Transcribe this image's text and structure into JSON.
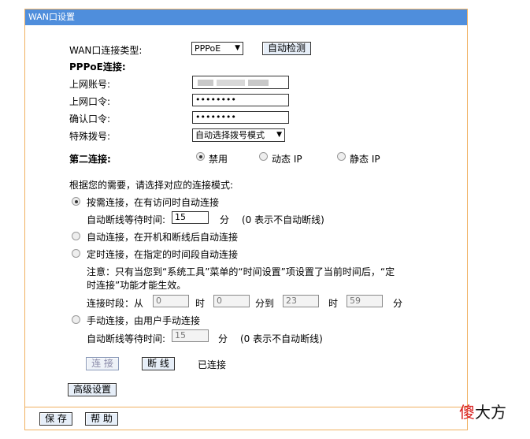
{
  "window_title": "WAN口设置",
  "conn_type": {
    "label": "WAN口连接类型:",
    "value": "PPPoE",
    "detect_button": "自动检测"
  },
  "pppoe": {
    "heading": "PPPoE连接:",
    "account_label": "上网账号:",
    "password_label": "上网口令:",
    "password_value": "••••••••",
    "confirm_label": "确认口令:",
    "confirm_value": "••••••••",
    "dial_label": "特殊拨号:",
    "dial_value": "自动选择拨号模式"
  },
  "secondary": {
    "label": "第二连接:",
    "options": [
      "禁用",
      "动态 IP",
      "静态 IP"
    ],
    "selected": 0
  },
  "mode": {
    "prompt": "根据您的需要，请选择对应的连接模式:",
    "on_demand": "按需连接，在有访问时自动连接",
    "idle_label": "自动断线等待时间:",
    "idle_value": "15",
    "unit": "分",
    "idle_note": "(0 表示不自动断线)",
    "auto": "自动连接，在开机和断线后自动连接",
    "timed": "定时连接，在指定的时间段自动连接",
    "note_line1": "注意：只有当您到“系统工具”菜单的“时间设置”项设置了当前时间后，“定",
    "note_line2": "时连接”功能才能生效。",
    "period_label": "连接时段：从",
    "from_h": "0",
    "hour": "时",
    "from_m": "0",
    "to_label": "分到",
    "to_h": "23",
    "to_m": "59",
    "manual": "手动连接，由用户手动连接",
    "manual_idle_value": "15",
    "selected": "on_demand"
  },
  "actions": {
    "connect": "连 接",
    "disconnect": "断 线",
    "status": "已连接"
  },
  "advanced": "高级设置",
  "footer": {
    "save": "保 存",
    "help": "帮 助"
  },
  "watermark": {
    "first": "傻",
    "rest": "大方"
  }
}
